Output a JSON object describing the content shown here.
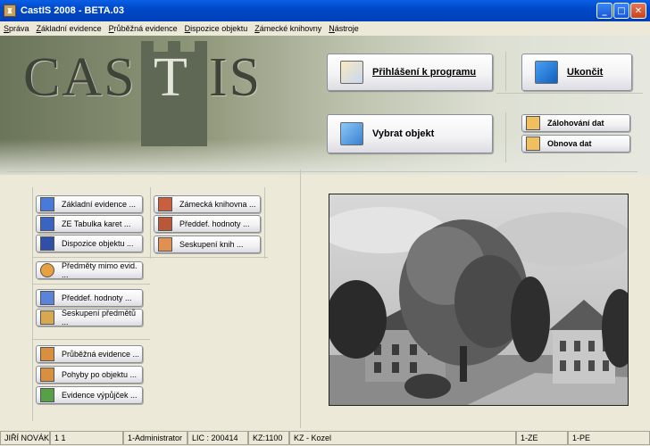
{
  "window": {
    "title": "CastIS 2008 - BETA.03",
    "minimize": "_",
    "maximize": "□",
    "close": "✕"
  },
  "menu": [
    "Správa",
    "Základní evidence",
    "Průběžná evidence",
    "Dispozice objektu",
    "Zámecké knihovny",
    "Nástroje"
  ],
  "logo": {
    "left": "CAS",
    "middle": "T",
    "right": "IS"
  },
  "top_buttons": {
    "login": "Přihlášení k programu",
    "quit": "Ukončit",
    "select_object": "Vybrat objekt",
    "backup": "Zálohování dat",
    "restore": "Obnova dat"
  },
  "left_buttons": {
    "basic_evidence": "Základní evidence ...",
    "ze_table": "ZE Tabulka karet ...",
    "object_disposition": "Dispozice objektu ...",
    "items_outside": "Předměty mimo evid. ...",
    "predef_values": "Předdef. hodnoty ...",
    "item_grouping": "Seskupení předmětů ...",
    "ongoing_evidence": "Průběžná evidence ...",
    "movements": "Pohyby po objektu ...",
    "loans": "Evidence výpůjček ..."
  },
  "library_buttons": {
    "library": "Zámecká knihovna ...",
    "predef_values": "Předdef. hodnoty ...",
    "book_grouping": "Seskupení knih ..."
  },
  "status": {
    "user": "JIŘÍ NOVÁK",
    "num": "1 1",
    "role": "1-Administrator",
    "lic": "LIC : 200414",
    "kz": "KZ:1100",
    "place": "KZ - Kozel",
    "ze": "1-ZE",
    "pe": "1-PE"
  }
}
